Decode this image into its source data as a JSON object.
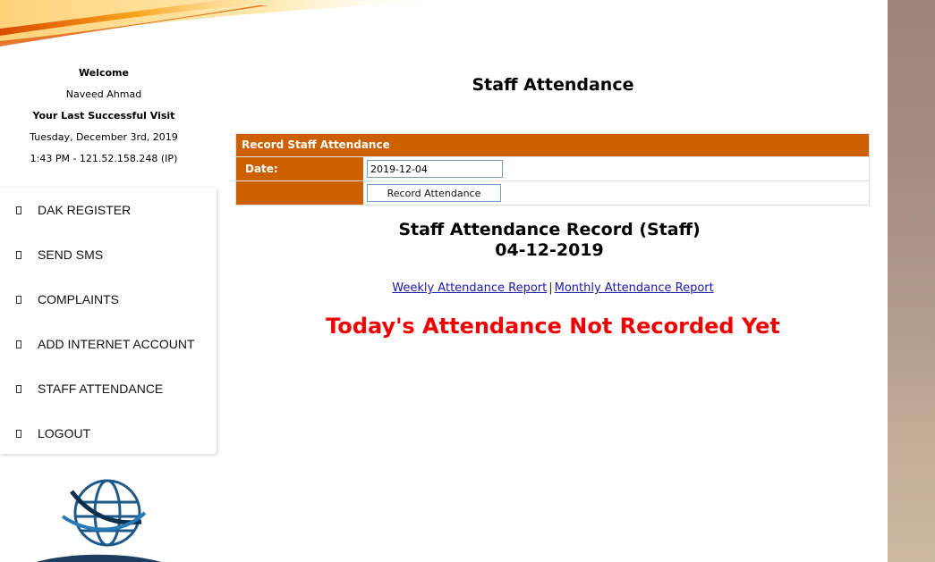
{
  "sidebar": {
    "welcome_label": "Welcome",
    "user_name": "Naveed Ahmad",
    "last_visit_label": "Your Last Successful Visit",
    "last_visit_date": "Tuesday, December 3rd, 2019",
    "last_visit_time_ip": "1:43 PM - 121.52.158.248 (IP)",
    "menu": [
      {
        "label": "DAK REGISTER",
        "icon": "square-icon"
      },
      {
        "label": "SEND SMS",
        "icon": "square-icon"
      },
      {
        "label": "COMPLAINTS",
        "icon": "square-icon"
      },
      {
        "label": "ADD INTERNET ACCOUNT",
        "icon": "square-icon"
      },
      {
        "label": "STAFF ATTENDANCE",
        "icon": "square-icon"
      },
      {
        "label": "LOGOUT",
        "icon": "square-icon"
      }
    ]
  },
  "main": {
    "title": "Staff Attendance",
    "form": {
      "header": "Record Staff Attendance",
      "date_label": "Date:",
      "date_value": "2019-12-04",
      "submit_label": "Record Attendance"
    },
    "record_title": "Staff Attendance Record (Staff)",
    "record_date": "04-12-2019",
    "links": {
      "weekly": "Weekly Attendance Report",
      "separator": "|",
      "monthly": "Monthly Attendance Report"
    },
    "status_message": "Today's Attendance Not Recorded Yet"
  },
  "colors": {
    "accent": "#cc6000",
    "status": "#f00000",
    "link": "#1a1aaa"
  }
}
